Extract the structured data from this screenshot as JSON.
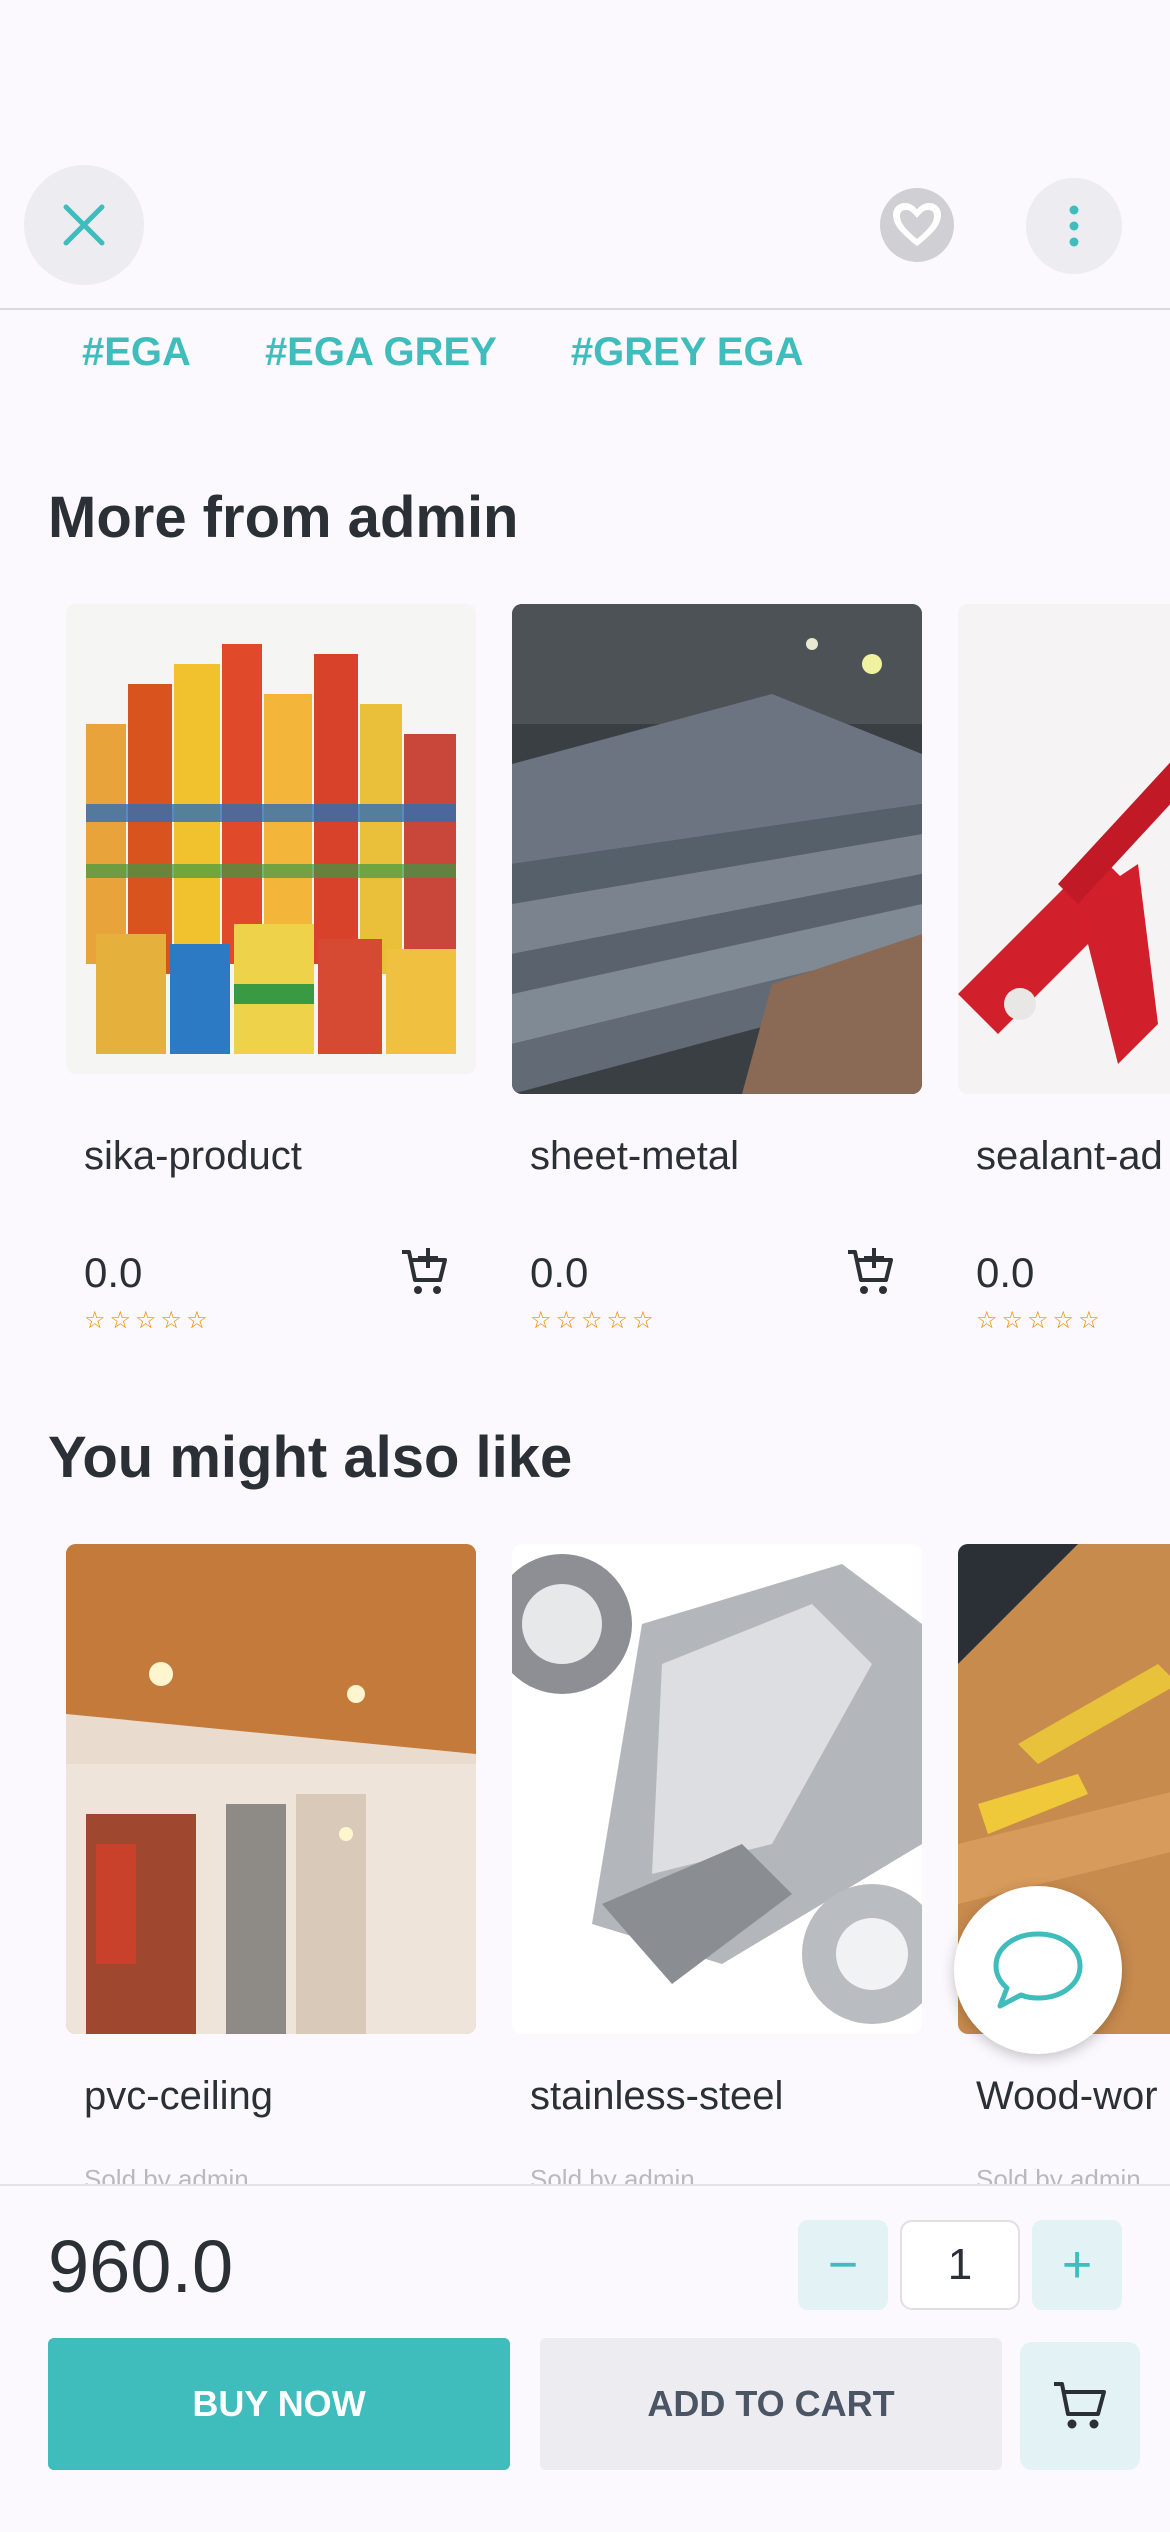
{
  "header": {
    "close_icon": "close-icon",
    "favorite_icon": "heart-icon",
    "menu_icon": "more-vertical-icon"
  },
  "tags": [
    "#EGA",
    "#EGA GREY",
    "#GREY EGA"
  ],
  "more_from": {
    "title": "More from admin",
    "products": [
      {
        "name": "sika-product",
        "price": "0.0",
        "rating": "☆☆☆☆☆"
      },
      {
        "name": "sheet-metal",
        "price": "0.0",
        "rating": "☆☆☆☆☆"
      },
      {
        "name": "sealant-ad",
        "price": "0.0",
        "rating": "☆☆☆☆☆"
      }
    ]
  },
  "also_like": {
    "title": "You might also like",
    "products": [
      {
        "name": "pvc-ceiling",
        "sold_by": "Sold by admin"
      },
      {
        "name": "stainless-steel",
        "sold_by": "Sold by admin"
      },
      {
        "name": "Wood-wor",
        "sold_by": "Sold by admin"
      }
    ]
  },
  "bottom": {
    "price": "960.0",
    "quantity": "1",
    "minus": "−",
    "plus": "+",
    "buy_now": "BUY NOW",
    "add_to_cart": "ADD TO CART"
  },
  "colors": {
    "accent": "#3fbcbc",
    "star": "#f08a00",
    "background": "#fbf9fd"
  }
}
